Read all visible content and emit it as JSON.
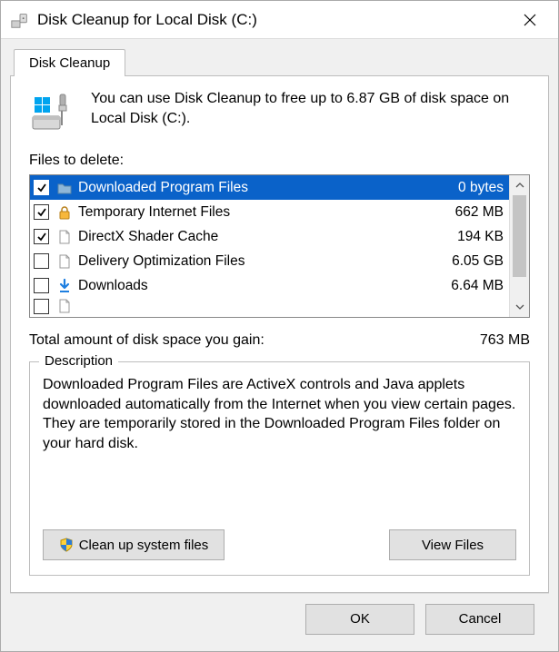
{
  "window": {
    "title": "Disk Cleanup for Local Disk (C:)"
  },
  "tab": {
    "label": "Disk Cleanup"
  },
  "intro": {
    "text": "You can use Disk Cleanup to free up to 6.87 GB of disk space on Local Disk (C:)."
  },
  "files_label": "Files to delete:",
  "items": [
    {
      "name": "Downloaded Program Files",
      "size": "0 bytes",
      "checked": true,
      "selected": true,
      "icon": "folder"
    },
    {
      "name": "Temporary Internet Files",
      "size": "662 MB",
      "checked": true,
      "selected": false,
      "icon": "lock"
    },
    {
      "name": "DirectX Shader Cache",
      "size": "194 KB",
      "checked": true,
      "selected": false,
      "icon": "file"
    },
    {
      "name": "Delivery Optimization Files",
      "size": "6.05 GB",
      "checked": false,
      "selected": false,
      "icon": "file"
    },
    {
      "name": "Downloads",
      "size": "6.64 MB",
      "checked": false,
      "selected": false,
      "icon": "download"
    }
  ],
  "total": {
    "label": "Total amount of disk space you gain:",
    "value": "763 MB"
  },
  "description": {
    "legend": "Description",
    "text": "Downloaded Program Files are ActiveX controls and Java applets downloaded automatically from the Internet when you view certain pages. They are temporarily stored in the Downloaded Program Files folder on your hard disk."
  },
  "buttons": {
    "cleanup_system": "Clean up system files",
    "view_files": "View Files",
    "ok": "OK",
    "cancel": "Cancel"
  }
}
